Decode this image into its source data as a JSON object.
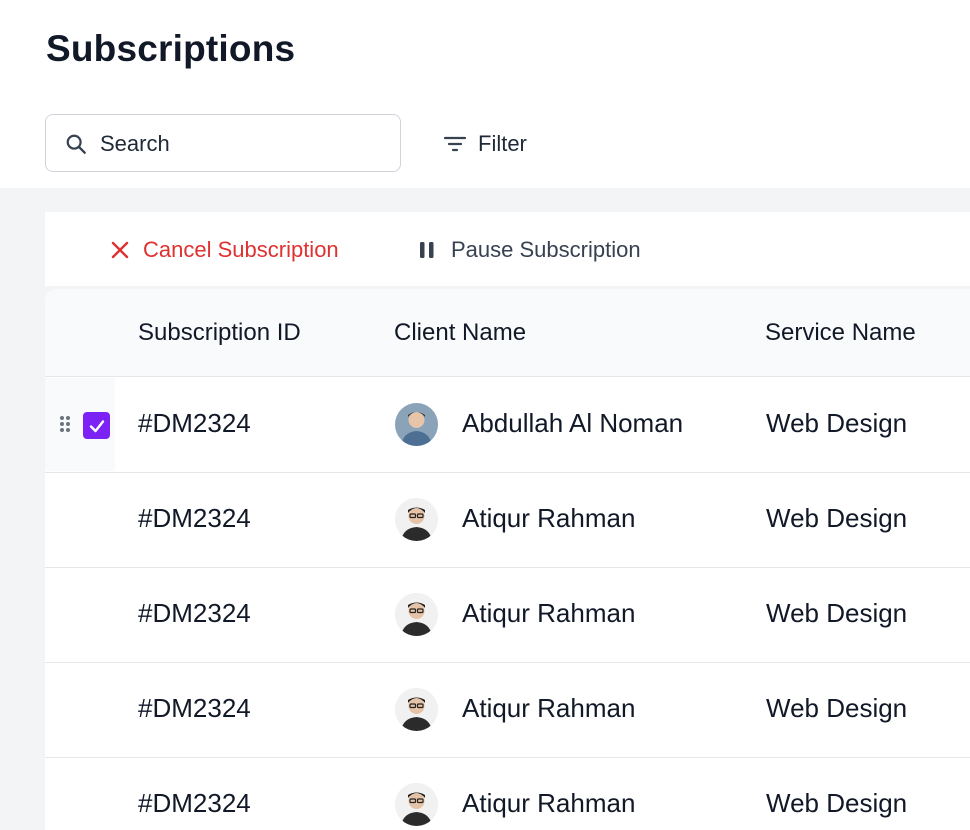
{
  "page": {
    "title": "Subscriptions"
  },
  "search": {
    "placeholder": "Search",
    "icon": "search-icon"
  },
  "filter": {
    "label": "Filter",
    "icon": "filter-lines-icon"
  },
  "actions": {
    "cancel": {
      "label": "Cancel Subscription",
      "icon": "close-icon",
      "color": "#e03131"
    },
    "pause": {
      "label": "Pause Subscription",
      "icon": "pause-icon"
    }
  },
  "table": {
    "columns": [
      "Subscription ID",
      "Client Name",
      "Service Name"
    ],
    "rows": [
      {
        "id": "#DM2324",
        "client": "Abdullah Al Noman",
        "service": "Web Design",
        "selected": true,
        "avatar": "avatar-noman"
      },
      {
        "id": "#DM2324",
        "client": "Atiqur Rahman",
        "service": "Web Design",
        "selected": false,
        "avatar": "avatar-atiqur"
      },
      {
        "id": "#DM2324",
        "client": "Atiqur Rahman",
        "service": "Web Design",
        "selected": false,
        "avatar": "avatar-atiqur"
      },
      {
        "id": "#DM2324",
        "client": "Atiqur Rahman",
        "service": "Web Design",
        "selected": false,
        "avatar": "avatar-atiqur"
      },
      {
        "id": "#DM2324",
        "client": "Atiqur Rahman",
        "service": "Web Design",
        "selected": false,
        "avatar": "avatar-atiqur"
      }
    ]
  },
  "colors": {
    "accent": "#7c22f5",
    "danger": "#e03131",
    "background": "#f3f4f6"
  }
}
